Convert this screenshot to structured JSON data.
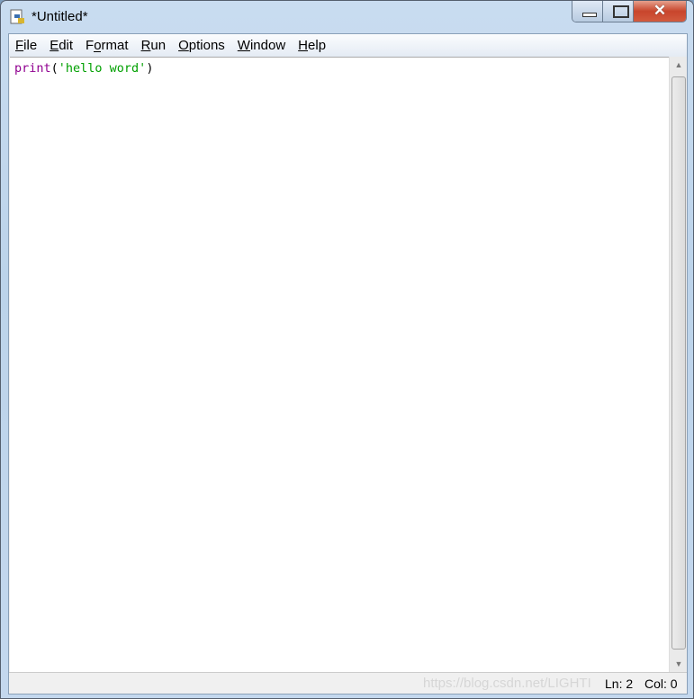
{
  "window": {
    "title": "*Untitled*",
    "app_icon": "python-idle-icon"
  },
  "menu": [
    {
      "label": "File",
      "accel": "F"
    },
    {
      "label": "Edit",
      "accel": "E"
    },
    {
      "label": "Format",
      "accel": "o"
    },
    {
      "label": "Run",
      "accel": "R"
    },
    {
      "label": "Options",
      "accel": "O"
    },
    {
      "label": "Window",
      "accel": "W"
    },
    {
      "label": "Help",
      "accel": "H"
    }
  ],
  "editor": {
    "keyword": "print",
    "open": "(",
    "string": "'hello word'",
    "close": ")"
  },
  "status": {
    "line": "Ln: 2",
    "col": "Col: 0",
    "watermark": "https://blog.csdn.net/LIGHTI"
  },
  "colors": {
    "keyword": "#900090",
    "string": "#00a000",
    "close_button": "#c8452c"
  }
}
